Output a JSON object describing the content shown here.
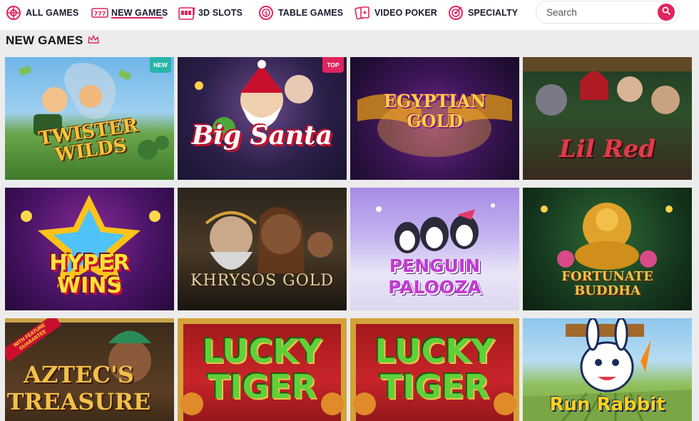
{
  "nav": {
    "items": [
      {
        "label": "ALL GAMES",
        "icon": "roulette-icon"
      },
      {
        "label": "NEW GAMES",
        "icon": "777-icon",
        "active": true
      },
      {
        "label": "3D SLOTS",
        "icon": "slot-machine-icon"
      },
      {
        "label": "TABLE GAMES",
        "icon": "chip-icon"
      },
      {
        "label": "VIDEO POKER",
        "icon": "cards-icon"
      },
      {
        "label": "SPECIALTY",
        "icon": "target-icon"
      }
    ],
    "accent": "#e0245e"
  },
  "search": {
    "placeholder": "Search",
    "icon": "search-icon"
  },
  "section": {
    "title": "NEW GAMES",
    "icon": "crown-icon"
  },
  "games": [
    {
      "title": "TWISTER WILDS",
      "badge": "NEW"
    },
    {
      "title": "Big Santa",
      "badge": "TOP"
    },
    {
      "title": "EGYPTIAN GOLD",
      "badge": ""
    },
    {
      "title": "Lil Red",
      "badge": ""
    },
    {
      "title": "HYPER WINS",
      "badge": ""
    },
    {
      "title": "KHRYSOS GOLD",
      "badge": ""
    },
    {
      "title": "PENGUIN PALOOZA",
      "badge": ""
    },
    {
      "title": "FORTUNATE BUDDHA",
      "badge": ""
    },
    {
      "title": "AZTEC'S TREASURE",
      "badge": "",
      "ribbon": "WITH FEATURE GUARANTEE"
    },
    {
      "title": "LUCKY TIGER",
      "badge": ""
    },
    {
      "title": "LUCKY TIGER",
      "badge": ""
    },
    {
      "title": "Run Rabbit",
      "badge": ""
    }
  ]
}
